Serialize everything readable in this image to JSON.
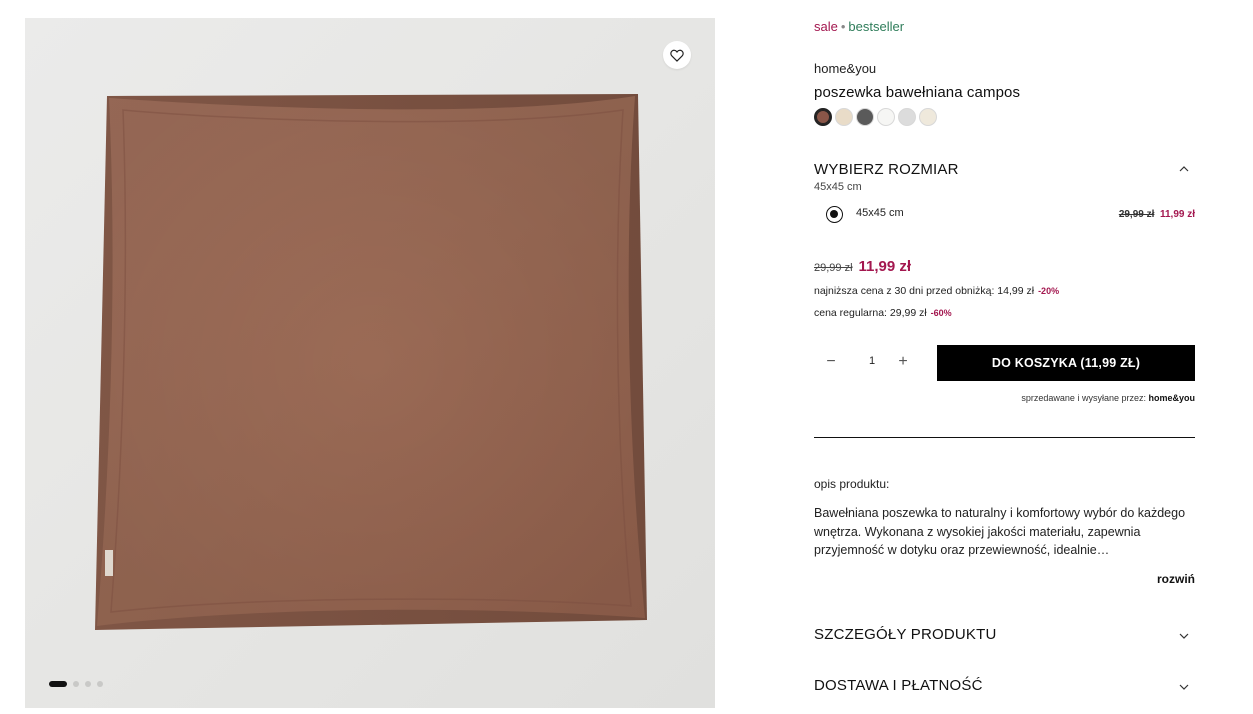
{
  "gallery": {
    "favorite_icon": "heart-outline-icon",
    "image_alt": "brown cotton pillowcase",
    "slides_total": 4,
    "active_slide": 1
  },
  "product": {
    "tags": {
      "sale": "sale",
      "separator": "•",
      "bestseller": "bestseller"
    },
    "brand": "home&you",
    "title": "poszewka bawełniana campos",
    "colors": [
      "#8a5648",
      "#e9dcc8",
      "#5a5a5a",
      "#f6f6f4",
      "#dcdcdc",
      "#efe9dc"
    ],
    "selected_color_index": 0
  },
  "size": {
    "heading": "WYBIERZ ROZMIAR",
    "selected": "45x45 cm",
    "options": [
      {
        "label": "45x45 cm",
        "old_price": "29,99 zł",
        "new_price": "11,99 zł"
      }
    ]
  },
  "price": {
    "old": "29,99 zł",
    "new": "11,99 zł",
    "lowest_label": "najniższa cena z 30 dni przed obniżką: 14,99 zł",
    "lowest_discount": "-20%",
    "regular_label": "cena regularna: 29,99 zł",
    "regular_discount": "-60%"
  },
  "cart": {
    "minus": "−",
    "quantity": "1",
    "plus": "+",
    "button_label": "DO KOSZYKA  (11,99 ZŁ)",
    "seller_prefix": "sprzedawane i wysyłane przez:",
    "seller_name": "home&you"
  },
  "description": {
    "heading": "opis produktu:",
    "text": "Bawełniana poszewka to naturalny i komfortowy wybór do każdego wnętrza. Wykonana z wysokiej jakości materiału, zapewnia przyjemność w dotyku oraz przewiewność, idealnie…",
    "expand_label": "rozwiń"
  },
  "accordions": {
    "details": "SZCZEGÓŁY PRODUKTU",
    "shipping": "DOSTAWA I PŁATNOŚĆ"
  },
  "icons": {
    "collapse": "chevron-up-icon",
    "expand": "chevron-down-icon"
  },
  "colors": {
    "accent": "#a3174f",
    "bestseller": "#2f7d5a",
    "button": "#000000"
  }
}
